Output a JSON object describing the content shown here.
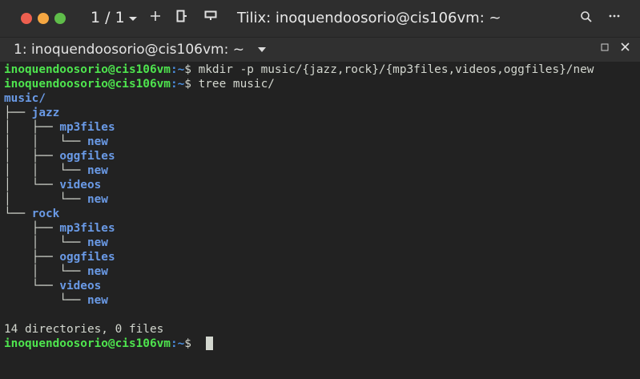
{
  "titlebar": {
    "session_count": "1 / 1",
    "title": "Tilix: inoquendoosorio@cis106vm: ~"
  },
  "tab": {
    "label": "1: inoquendoosorio@cis106vm: ~"
  },
  "terminal": {
    "user": "inoquendoosorio@cis106vm",
    "path": ":~",
    "commands": [
      "$ mkdir -p music/{jazz,rock}/{mp3files,videos,oggfiles}/new",
      "$ tree music/"
    ],
    "tree": [
      {
        "prefix": "",
        "name": "music/"
      },
      {
        "prefix": "├── ",
        "name": "jazz"
      },
      {
        "prefix": "│   ├── ",
        "name": "mp3files"
      },
      {
        "prefix": "│   │   └── ",
        "name": "new"
      },
      {
        "prefix": "│   ├── ",
        "name": "oggfiles"
      },
      {
        "prefix": "│   │   └── ",
        "name": "new"
      },
      {
        "prefix": "│   └── ",
        "name": "videos"
      },
      {
        "prefix": "│       └── ",
        "name": "new"
      },
      {
        "prefix": "└── ",
        "name": "rock"
      },
      {
        "prefix": "    ├── ",
        "name": "mp3files"
      },
      {
        "prefix": "    │   └── ",
        "name": "new"
      },
      {
        "prefix": "    ├── ",
        "name": "oggfiles"
      },
      {
        "prefix": "    │   └── ",
        "name": "new"
      },
      {
        "prefix": "    └── ",
        "name": "videos"
      },
      {
        "prefix": "        └── ",
        "name": "new"
      }
    ],
    "summary": "14 directories, 0 files",
    "final_prompt_symbol": "$"
  },
  "icons": {
    "session_dropdown": "chevron-down-icon",
    "add_terminal": "plus-icon",
    "split_right": "split-right-icon",
    "split_down": "split-down-icon",
    "search": "search-icon",
    "menu": "more-icon",
    "maximize": "maximize-icon",
    "close": "close-icon"
  }
}
